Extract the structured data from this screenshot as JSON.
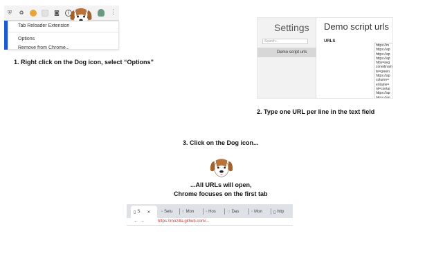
{
  "step1": {
    "menu": {
      "item_extension": "Tab Reloader Extension",
      "item_options": "Options",
      "item_remove": "Remove from Chrome..."
    },
    "caption": "1. Right click on the Dog icon, select “Options”"
  },
  "step2": {
    "sidebar_title": "Settings",
    "search_placeholder": "Search...",
    "nav_item": "Demo script urls",
    "heading": "Demo script urls",
    "urls_label": "URLS",
    "url_lines": [
      "https://m",
      "https://ap",
      "https://ap",
      "https://ap",
      "hlby=avg",
      "zone&nam",
      "te=green",
      "https://ap",
      "column=",
      "entaine=",
      "nt=contai",
      "https://ap",
      "https://ap"
    ],
    "caption": "2. Type one URL per line in the text field"
  },
  "step3": {
    "caption": "3. Click on the Dog icon...",
    "result_line1": "...All URLs will open,",
    "result_line2": "Chrome focuses on the first tab",
    "tabs": [
      "S",
      "Setu",
      "Mon",
      "Hos",
      "Das",
      "Mon",
      "http"
    ],
    "address_text": "https://mozilla.github.com/..."
  },
  "colors": {
    "accent_blue": "#1f5bd6",
    "dog_brown": "#a0632e",
    "link_red": "#cc3333"
  }
}
